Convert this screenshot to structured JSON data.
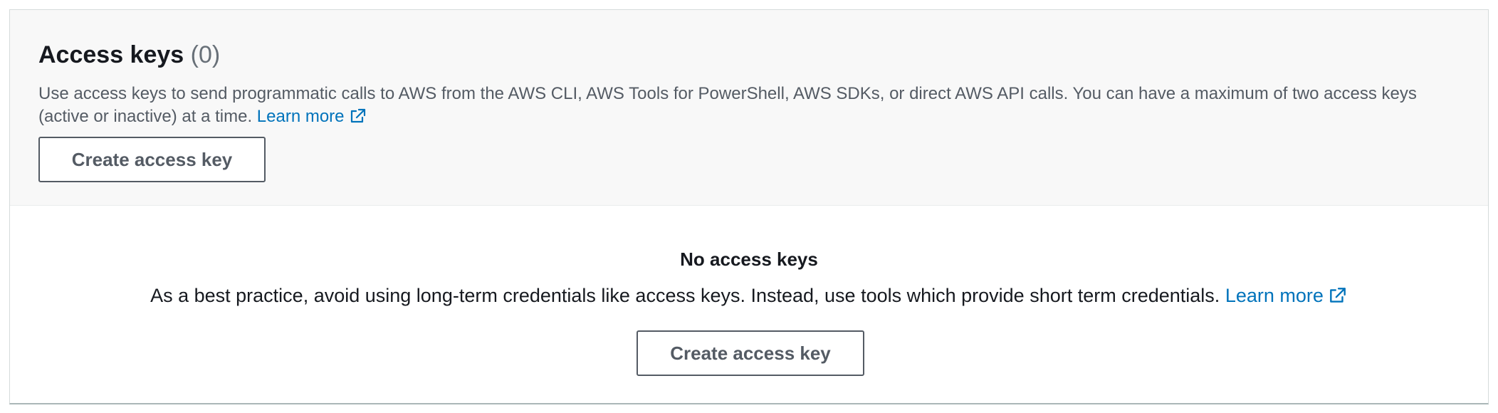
{
  "header": {
    "title": "Access keys",
    "count": "(0)",
    "description": "Use access keys to send programmatic calls to AWS from the AWS CLI, AWS Tools for PowerShell, AWS SDKs, or direct AWS API calls. You can have a maximum of two access keys (active or inactive) at a time.",
    "learn_more_label": "Learn more",
    "create_button_label": "Create access key"
  },
  "empty_state": {
    "title": "No access keys",
    "text": "As a best practice, avoid using long-term credentials like access keys. Instead, use tools which provide short term credentials.",
    "learn_more_label": "Learn more",
    "create_button_label": "Create access key"
  },
  "icons": {
    "external_link": "external-link-icon"
  },
  "colors": {
    "link": "#0073bb",
    "button_border": "#545b64",
    "header_bg": "#f8f8f8"
  }
}
